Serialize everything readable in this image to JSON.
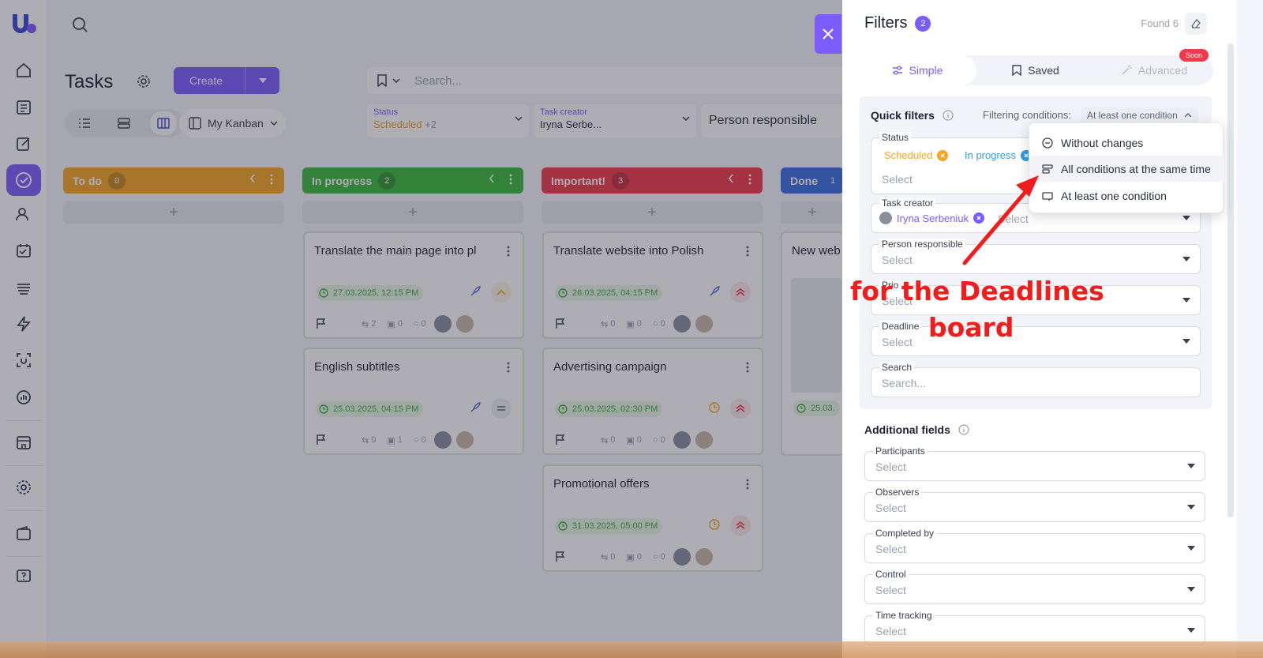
{
  "app": {
    "title": "Tasks",
    "search_placeholder": "Search..."
  },
  "toolbar": {
    "create_label": "Create",
    "kanban_label": "My Kanban"
  },
  "filters_bar": {
    "status_caption": "Status",
    "status_value": "Scheduled",
    "status_more": "+2",
    "creator_caption": "Task creator",
    "creator_value": "Iryna Serbe...",
    "person_responsible": "Person responsible"
  },
  "columns": [
    {
      "name": "To do",
      "count": "0",
      "color": "#f5a623"
    },
    {
      "name": "In progress",
      "count": "2",
      "color": "#3db93d"
    },
    {
      "name": "Important!",
      "count": "3",
      "color": "#f0394b"
    },
    {
      "name": "Done",
      "count": "1",
      "color": "#3b6fe0"
    }
  ],
  "cards": [
    {
      "title": "Translate the main page into pl",
      "date": "27.03.2025, 12:15 PM",
      "subtasks": "2",
      "checklist": "0",
      "comments": "0"
    },
    {
      "title": "English subtitles",
      "date": "25.03.2025, 04:15 PM",
      "subtasks": "0",
      "checklist": "1",
      "comments": "0"
    },
    {
      "title": "Translate website into Polish",
      "date": "26.03.2025, 04:15 PM",
      "subtasks": "0",
      "checklist": "0",
      "comments": "0"
    },
    {
      "title": "Advertising campaign",
      "date": "25.03.2025, 02:30 PM",
      "subtasks": "0",
      "checklist": "0",
      "comments": "0"
    },
    {
      "title": "Promotional offers",
      "date": "31.03.2025, 05:00 PM",
      "subtasks": "0",
      "checklist": "0",
      "comments": "0"
    },
    {
      "title": "New web",
      "date": "25.03."
    }
  ],
  "panel": {
    "title": "Filters",
    "badge": "2",
    "found": "Found 6",
    "tabs": {
      "simple": "Simple",
      "saved": "Saved",
      "advanced": "Advanced",
      "soon": "Soon"
    },
    "quick_filters": "Quick filters",
    "filtering_conditions_label": "Filtering conditions:",
    "filtering_conditions_value": "At least one condition",
    "status": {
      "label": "Status",
      "chip1": "Scheduled",
      "chip2": "In progress",
      "placeholder": "Select"
    },
    "task_creator": {
      "label": "Task creator",
      "chip": "Iryna Serbeniuk",
      "placeholder": "Select"
    },
    "person_responsible": {
      "label": "Person responsible",
      "placeholder": "Select"
    },
    "priority": {
      "label": "Prio",
      "placeholder": "Select"
    },
    "deadline": {
      "label": "Deadline",
      "placeholder": "Select"
    },
    "search": {
      "label": "Search",
      "placeholder": "Search..."
    },
    "additional_fields": "Additional fields",
    "participants": {
      "label": "Participants",
      "placeholder": "Select"
    },
    "observers": {
      "label": "Observers",
      "placeholder": "Select"
    },
    "completed_by": {
      "label": "Completed by",
      "placeholder": "Select"
    },
    "control": {
      "label": "Control",
      "placeholder": "Select"
    },
    "time_tracking": {
      "label": "Time tracking",
      "placeholder": "Select"
    }
  },
  "dropdown": {
    "items": [
      "Without changes",
      "All conditions at the same time",
      "At least one condition"
    ]
  },
  "annotation": {
    "line1": "for the Deadlines",
    "line2": "board",
    "color": "#f21c1c"
  }
}
